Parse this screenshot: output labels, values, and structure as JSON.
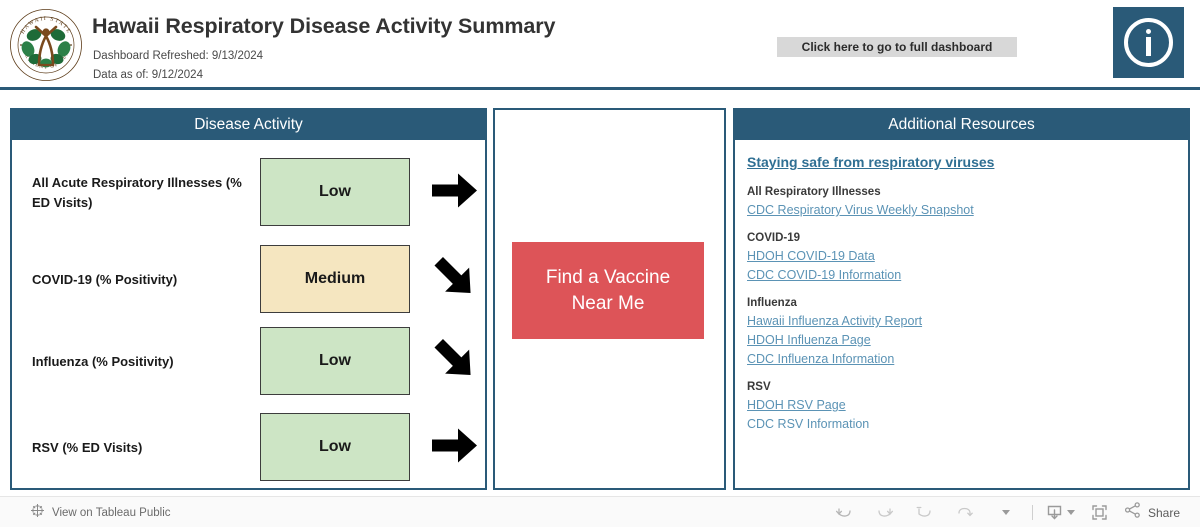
{
  "header": {
    "logo_alt": "Hawaii State Department of Health seal",
    "logo_ring_text_top": "HAWAII STATE",
    "logo_ring_text_bottom": "DEPARTMENT OF HEALTH",
    "title": "Hawaii Respiratory Disease Activity Summary",
    "refreshed_label": "Dashboard Refreshed: 9/13/2024",
    "data_as_of_label": "Data as of: 9/12/2024",
    "dashboard_button": "Click here to go to full dashboard",
    "info_icon": "info-icon",
    "rule_color": "#2a5a78"
  },
  "colors": {
    "teal": "#2a5a78",
    "low_green": "#cde5c5",
    "medium_tan": "#f5e6c0",
    "red_button": "#dd5458",
    "link_blue": "#5b93b5",
    "lead_link_blue": "#2f6f93"
  },
  "disease_activity": {
    "panel_title": "Disease Activity",
    "rows": [
      {
        "label": "All Acute Respiratory Illnesses (% ED Visits)",
        "level": "Low",
        "level_color": "#cde5c5",
        "trend": "right",
        "trend_name": "arrow-right-icon"
      },
      {
        "label": "COVID-19 (% Positivity)",
        "level": "Medium",
        "level_color": "#f5e6c0",
        "trend": "down-right",
        "trend_name": "arrow-down-right-icon"
      },
      {
        "label": "Influenza (% Positivity)",
        "level": "Low",
        "level_color": "#cde5c5",
        "trend": "down-right",
        "trend_name": "arrow-down-right-icon"
      },
      {
        "label": "RSV (% ED Visits)",
        "level": "Low",
        "level_color": "#cde5c5",
        "trend": "right",
        "trend_name": "arrow-right-icon"
      }
    ]
  },
  "vaccine": {
    "button_line1": "Find a Vaccine",
    "button_line2": "Near Me"
  },
  "resources": {
    "panel_title": "Additional Resources",
    "lead_link": "Staying safe from respiratory viruses",
    "groups": [
      {
        "heading": "All Respiratory Illnesses",
        "links": [
          {
            "label": "CDC Respiratory Virus Weekly Snapshot",
            "underlined": true
          }
        ]
      },
      {
        "heading": "COVID-19",
        "links": [
          {
            "label": "HDOH COVID-19 Data",
            "underlined": true
          },
          {
            "label": "CDC COVID-19 Information",
            "underlined": true
          }
        ]
      },
      {
        "heading": "Influenza",
        "links": [
          {
            "label": "Hawaii Influenza Activity Report",
            "underlined": true
          },
          {
            "label": "HDOH Influenza Page",
            "underlined": true
          },
          {
            "label": "CDC Influenza Information",
            "underlined": true
          }
        ]
      },
      {
        "heading": "RSV",
        "links": [
          {
            "label": "HDOH RSV Page",
            "underlined": true
          },
          {
            "label": "CDC RSV Information",
            "underlined": false
          }
        ]
      }
    ]
  },
  "toolbar": {
    "tableau_label": "View on Tableau Public",
    "tableau_icon": "tableau-logo-icon",
    "buttons": [
      {
        "name": "undo-icon",
        "title": "Undo"
      },
      {
        "name": "redo-icon",
        "title": "Redo"
      },
      {
        "name": "revert-icon",
        "title": "Revert"
      },
      {
        "name": "refresh-icon",
        "title": "Refresh"
      },
      {
        "name": "chevron-down-icon",
        "title": "More"
      },
      {
        "name": "download-icon",
        "title": "Download"
      },
      {
        "name": "fullscreen-icon",
        "title": "Full Screen"
      }
    ],
    "share_label": "Share",
    "share_icon": "share-icon"
  }
}
